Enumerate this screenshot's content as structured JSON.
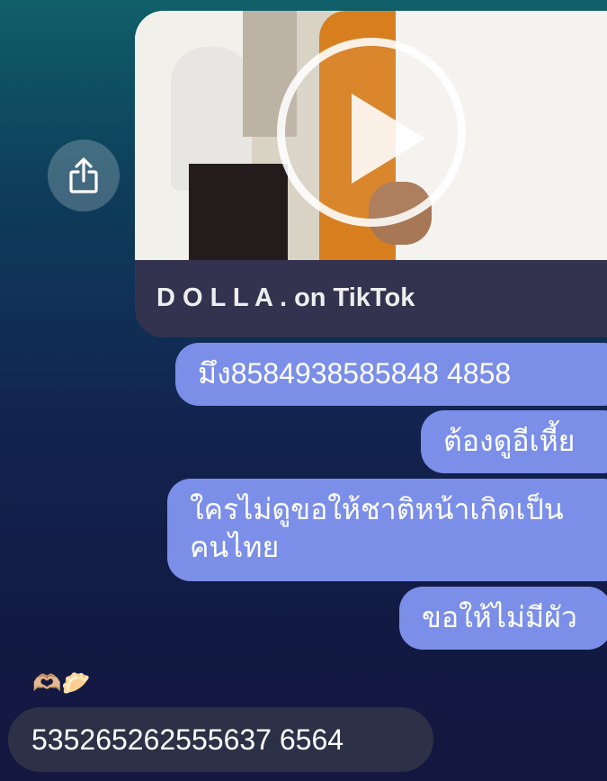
{
  "share_icon": "share-icon",
  "link_preview": {
    "title": "D O L L A . on TikTok",
    "play_icon": "play-icon"
  },
  "outgoing_messages": [
    "มึง8584938585848 4858",
    "ต้องดูอีเหี้ย",
    "ใครไม่ดูขอให้ชาติหน้าเกิดเป็นคนไทย",
    "ขอให้ไม่มีผัว"
  ],
  "reactions": "🫶🏼🥟",
  "incoming_message": "535265262555637 6564",
  "colors": {
    "outgoing_bubble": "#7b8ee8",
    "incoming_bubble": "#2c3147",
    "card_bg": "#33334f"
  }
}
